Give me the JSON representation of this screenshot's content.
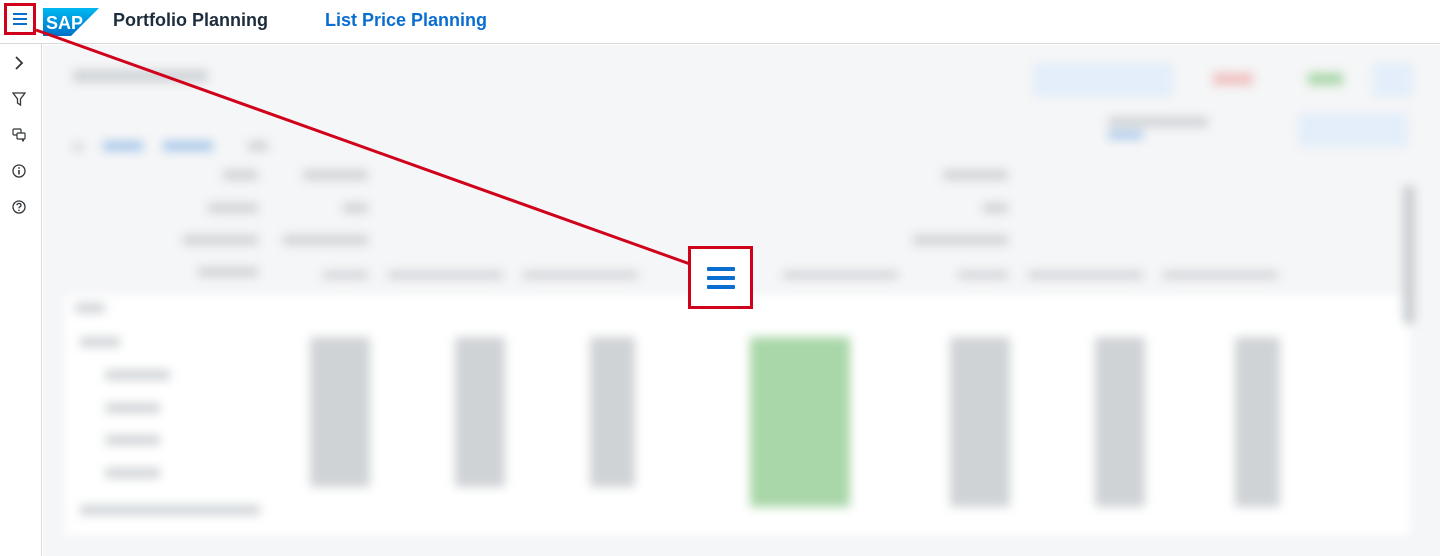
{
  "header": {
    "menu_icon": "hamburger-menu-icon",
    "logo_text": "SAP",
    "app_title": "Portfolio Planning",
    "app_link": "List Price Planning"
  },
  "sidebar": {
    "icons": [
      "chevron-right-icon",
      "filter-icon",
      "comments-icon",
      "info-icon",
      "help-icon"
    ]
  },
  "annotation": {
    "highlight_color": "#d0021b",
    "zoom_icon": "hamburger-menu-icon"
  },
  "colors": {
    "brand_blue": "#0a6ed1",
    "title_text": "#1d2d3e",
    "annotation_red": "#d0021b"
  }
}
